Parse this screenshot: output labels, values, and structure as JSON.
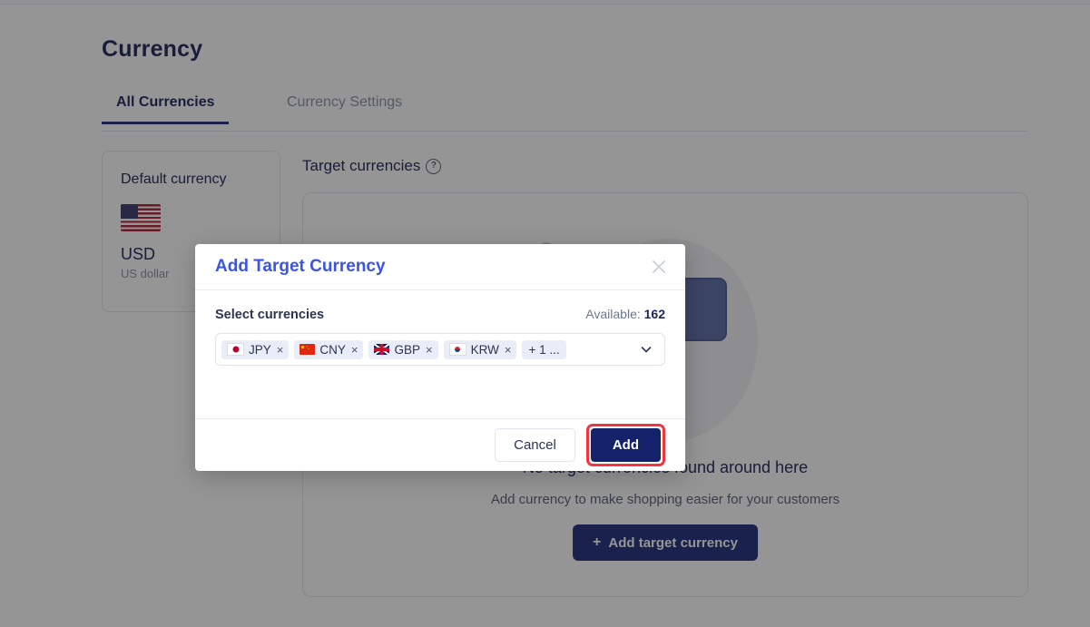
{
  "page": {
    "title": "Currency",
    "tabs": [
      {
        "label": "All Currencies",
        "active": true
      },
      {
        "label": "Currency Settings",
        "active": false
      }
    ],
    "default_currency": {
      "heading": "Default currency",
      "flag": "us-flag-icon",
      "code": "USD",
      "name": "US dollar"
    },
    "target_currencies": {
      "heading": "Target currencies",
      "help_glyph": "?",
      "empty_title": "No target currencies found around here",
      "empty_subtitle": "Add currency to make shopping easier for your customers",
      "add_button_label": "Add target currency",
      "add_button_plus": "+"
    }
  },
  "modal": {
    "title": "Add Target Currency",
    "close_icon": "close-icon",
    "select_label": "Select currencies",
    "available_prefix": "Available:",
    "available_count": "162",
    "chips": [
      {
        "code": "JPY",
        "flag": "jp-flag-icon",
        "remove": "×"
      },
      {
        "code": "CNY",
        "flag": "cn-flag-icon",
        "remove": "×"
      },
      {
        "code": "GBP",
        "flag": "gb-flag-icon",
        "remove": "×"
      },
      {
        "code": "KRW",
        "flag": "kr-flag-icon",
        "remove": "×"
      }
    ],
    "overflow_label": "+ 1 ...",
    "cancel_label": "Cancel",
    "add_label": "Add"
  },
  "colors": {
    "brand_navy": "#1f2d7b",
    "modal_title_blue": "#3c55e0",
    "add_button_navy": "#13226b",
    "highlight_red": "#f5333f",
    "text_dark": "#1b2559",
    "text_muted": "#8a92a6"
  }
}
